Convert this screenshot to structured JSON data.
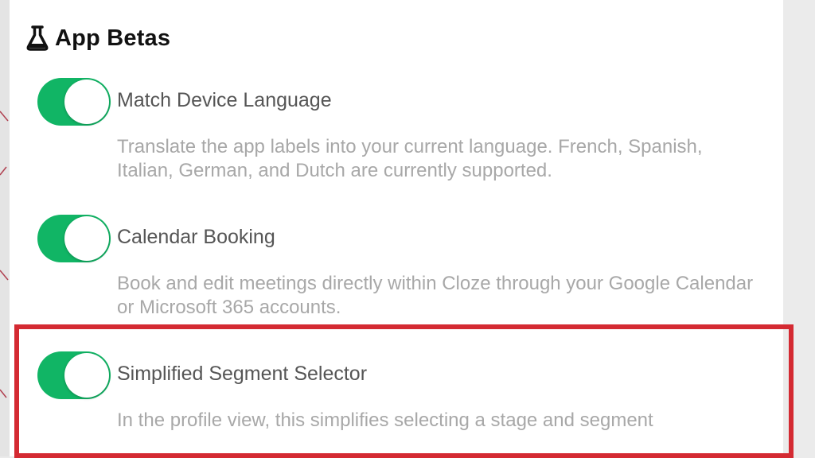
{
  "section": {
    "title": "App Betas",
    "icon": "flask-icon"
  },
  "settings": [
    {
      "label": "Match Device Language",
      "description": "Translate the app labels into your current language. French, Spanish, Italian, German, and Dutch are currently supported.",
      "enabled": true
    },
    {
      "label": "Calendar Booking",
      "description": "Book and edit meetings directly within Cloze through your Google Calendar or Microsoft 365 accounts.",
      "enabled": true
    },
    {
      "label": "Simplified Segment Selector",
      "description": "In the profile view, this simplifies selecting a stage and segment",
      "enabled": true
    }
  ],
  "colors": {
    "toggle_on": "#11b565",
    "highlight": "#d42a32",
    "label": "#555555",
    "description": "#a8a8a8"
  }
}
